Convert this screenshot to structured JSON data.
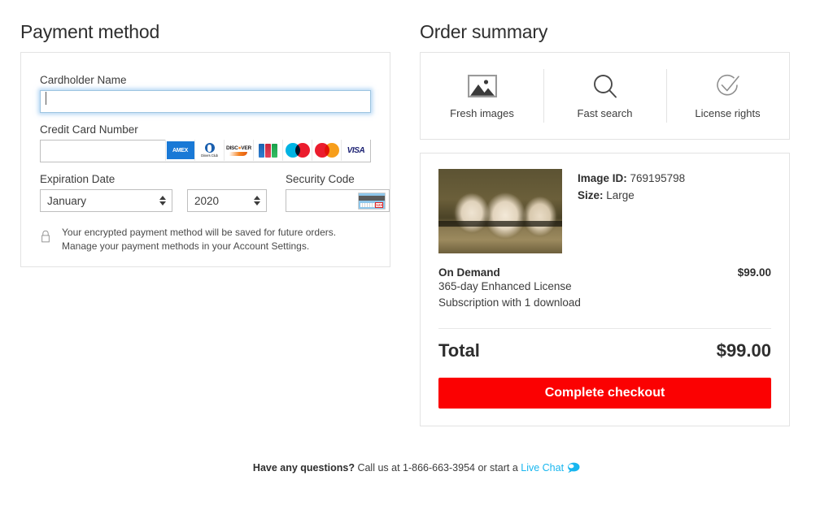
{
  "payment": {
    "title": "Payment method",
    "cardholder": {
      "label": "Cardholder Name",
      "value": "",
      "placeholder": ""
    },
    "card_number": {
      "label": "Credit Card Number",
      "value": "",
      "placeholder": "",
      "accepted_cards": [
        "AMEX",
        "Diners Club",
        "DISCOVER",
        "JCB",
        "Maestro",
        "Mastercard",
        "VISA"
      ]
    },
    "expiration": {
      "label": "Expiration Date",
      "month": "January",
      "year": "2020"
    },
    "security": {
      "label": "Security Code",
      "value": "",
      "icon": "credit-card-back-icon"
    },
    "notice": {
      "icon": "lock-icon",
      "text": "Your encrypted payment method will be saved for future orders. Manage your payment methods in your Account Settings."
    }
  },
  "summary": {
    "title": "Order summary",
    "features": [
      {
        "icon": "image-icon",
        "label": "Fresh images"
      },
      {
        "icon": "search-icon",
        "label": "Fast search"
      },
      {
        "icon": "check-circle-icon",
        "label": "License rights"
      }
    ],
    "item": {
      "thumbnail_alt": "skulls-photo-thumbnail",
      "image_id_label": "Image ID:",
      "image_id": "769195798",
      "size_label": "Size:",
      "size": "Large"
    },
    "license": {
      "name": "On Demand",
      "price": "$99.00",
      "line2": "365-day Enhanced License",
      "line3": "Subscription with 1 download"
    },
    "total": {
      "label": "Total",
      "amount": "$99.00"
    },
    "checkout_button": "Complete checkout"
  },
  "footer": {
    "question": "Have any questions?",
    "call_text": " Call us at 1-866-663-3954 or start a ",
    "live_chat": "Live Chat",
    "chat_icon": "chat-bubble-icon"
  },
  "colors": {
    "checkout_red": "#fb0102",
    "live_chat_cyan": "#18b6ef",
    "focus_blue": "#9dc4e0",
    "border_grey": "#e3e3e3"
  }
}
